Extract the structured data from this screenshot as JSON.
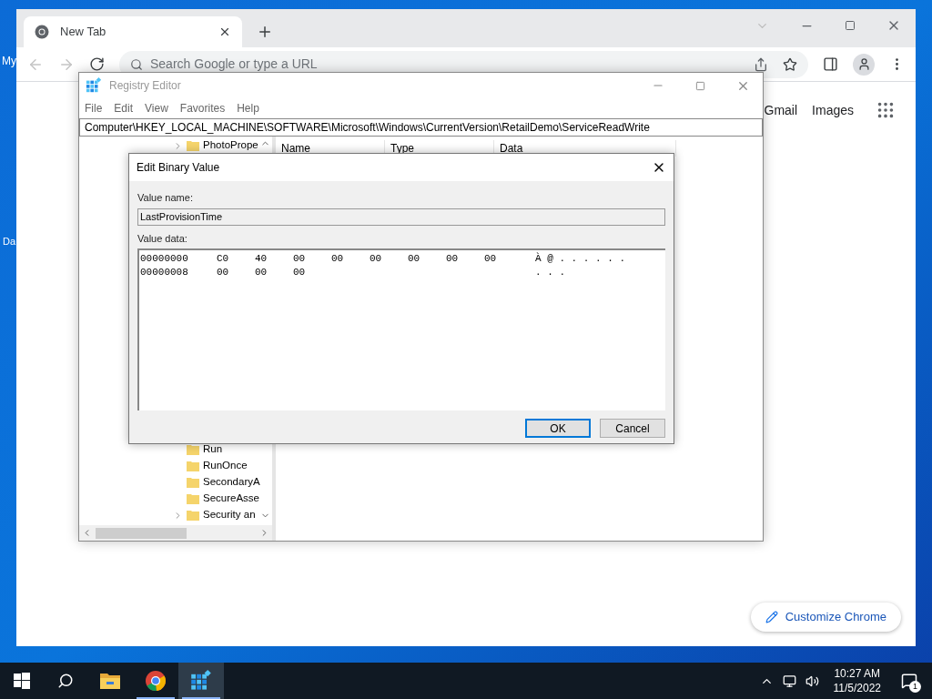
{
  "desktop": {
    "icons": [
      {
        "label": "My"
      },
      {
        "label": "Da"
      }
    ]
  },
  "browser": {
    "tabs": [
      {
        "title": "New Tab",
        "selected": true
      }
    ],
    "back_disabled": true,
    "forward_disabled": true,
    "omnibox": {
      "placeholder": "Search Google or type a URL"
    },
    "links": [
      "Gmail",
      "Images"
    ],
    "customize_button": "Customize Chrome"
  },
  "regedit": {
    "title": "Registry Editor",
    "menu": [
      "File",
      "Edit",
      "View",
      "Favorites",
      "Help"
    ],
    "address": "Computer\\HKEY_LOCAL_MACHINE\\SOFTWARE\\Microsoft\\Windows\\CurrentVersion\\RetailDemo\\ServiceReadWrite",
    "tree_top": [
      {
        "label": "PhotoPrope",
        "has_children": true
      }
    ],
    "tree_bottom": [
      {
        "label": "Run",
        "has_children": false
      },
      {
        "label": "RunOnce",
        "has_children": false
      },
      {
        "label": "SecondaryA",
        "has_children": false
      },
      {
        "label": "SecureAsse",
        "has_children": false
      },
      {
        "label": "Security an",
        "has_children": true
      }
    ],
    "columns": [
      "Name",
      "Type",
      "Data"
    ]
  },
  "dialog": {
    "title": "Edit Binary Value",
    "name_label": "Value name:",
    "name_value": "LastProvisionTime",
    "data_label": "Value data:",
    "rows": [
      {
        "address": "00000000",
        "bytes": [
          "C0",
          "40",
          "00",
          "00",
          "00",
          "00",
          "00",
          "00"
        ],
        "ascii": "À @ . . . . . ."
      },
      {
        "address": "00000008",
        "bytes": [
          "00",
          "00",
          "00"
        ],
        "ascii": ". . ."
      }
    ],
    "buttons": [
      {
        "label": "OK",
        "default": true
      },
      {
        "label": "Cancel",
        "default": false
      }
    ]
  },
  "taskbar": {
    "apps": [
      {
        "kind": "explorer",
        "running": false,
        "selected": false
      },
      {
        "kind": "chrome",
        "running": true,
        "selected": false
      },
      {
        "kind": "regedit",
        "running": true,
        "selected": true
      }
    ],
    "time": "10:27 AM",
    "date": "11/5/2022",
    "notifications": "1"
  }
}
